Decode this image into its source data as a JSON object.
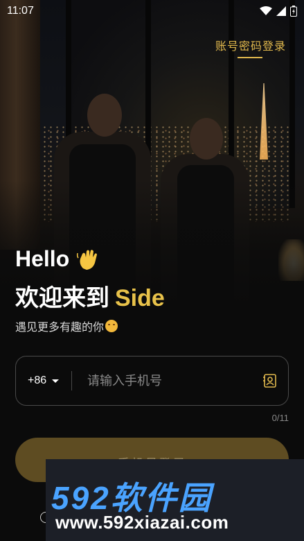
{
  "status_bar": {
    "time": "11:07",
    "icons": [
      "wifi-icon",
      "signal-icon",
      "battery-icon"
    ]
  },
  "header": {
    "account_login": "账号密码登录"
  },
  "hero": {
    "hello": "Hello",
    "hello_emoji": "waving-hand-icon",
    "welcome_prefix": "欢迎来到",
    "brand": "Side",
    "subtitle": "遇见更多有趣的你"
  },
  "phone": {
    "country_code": "+86",
    "placeholder": "请输入手机号",
    "counter": "0/11"
  },
  "actions": {
    "login_label": "手机号登录"
  },
  "watermark": {
    "brand": "592软件园",
    "url": "www.592xiazai.com"
  },
  "colors": {
    "accent": "#e0b84d",
    "brand": "#e8c24a",
    "button_bg": "#5e4c22",
    "background": "#0b0b0b",
    "watermark_blue": "#4aa3ff"
  }
}
